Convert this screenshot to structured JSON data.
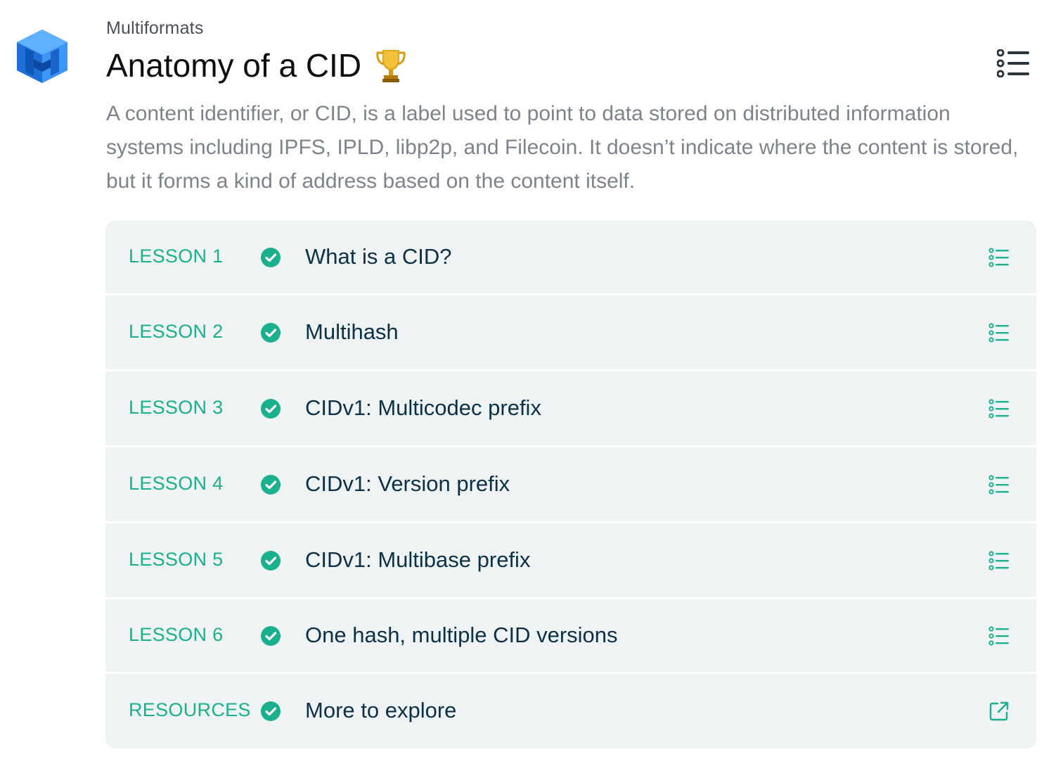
{
  "header": {
    "eyebrow": "Multiformats",
    "title": "Anatomy of a CID",
    "title_emoji_icon": "trophy-icon",
    "menu_icon": "list-icon",
    "logo_icon": "multiformats-logo"
  },
  "description": "A content identifier, or CID, is a label used to point to data stored on distributed information systems including IPFS, IPLD, libp2p, and Filecoin. It doesn’t indicate where the content is stored, but it forms a kind of address based on the content itself.",
  "colors": {
    "accent": "#19b08e",
    "title_text": "#0b3148",
    "description_text": "#7c838c",
    "row_bg": "#eff3f4",
    "logo_blue": "#1f7ae8"
  },
  "lessons": [
    {
      "label": "LESSON 1",
      "title": "What is a CID?",
      "status_icon": "check-circle-icon",
      "action_icon": "list-icon"
    },
    {
      "label": "LESSON 2",
      "title": "Multihash",
      "status_icon": "check-circle-icon",
      "action_icon": "list-icon"
    },
    {
      "label": "LESSON 3",
      "title": "CIDv1: Multicodec prefix",
      "status_icon": "check-circle-icon",
      "action_icon": "list-icon"
    },
    {
      "label": "LESSON 4",
      "title": "CIDv1: Version prefix",
      "status_icon": "check-circle-icon",
      "action_icon": "list-icon"
    },
    {
      "label": "LESSON 5",
      "title": "CIDv1: Multibase prefix",
      "status_icon": "check-circle-icon",
      "action_icon": "list-icon"
    },
    {
      "label": "LESSON 6",
      "title": "One hash, multiple CID versions",
      "status_icon": "check-circle-icon",
      "action_icon": "list-icon"
    },
    {
      "label": "RESOURCES",
      "title": "More to explore",
      "status_icon": "check-circle-icon",
      "action_icon": "external-link-icon"
    }
  ]
}
